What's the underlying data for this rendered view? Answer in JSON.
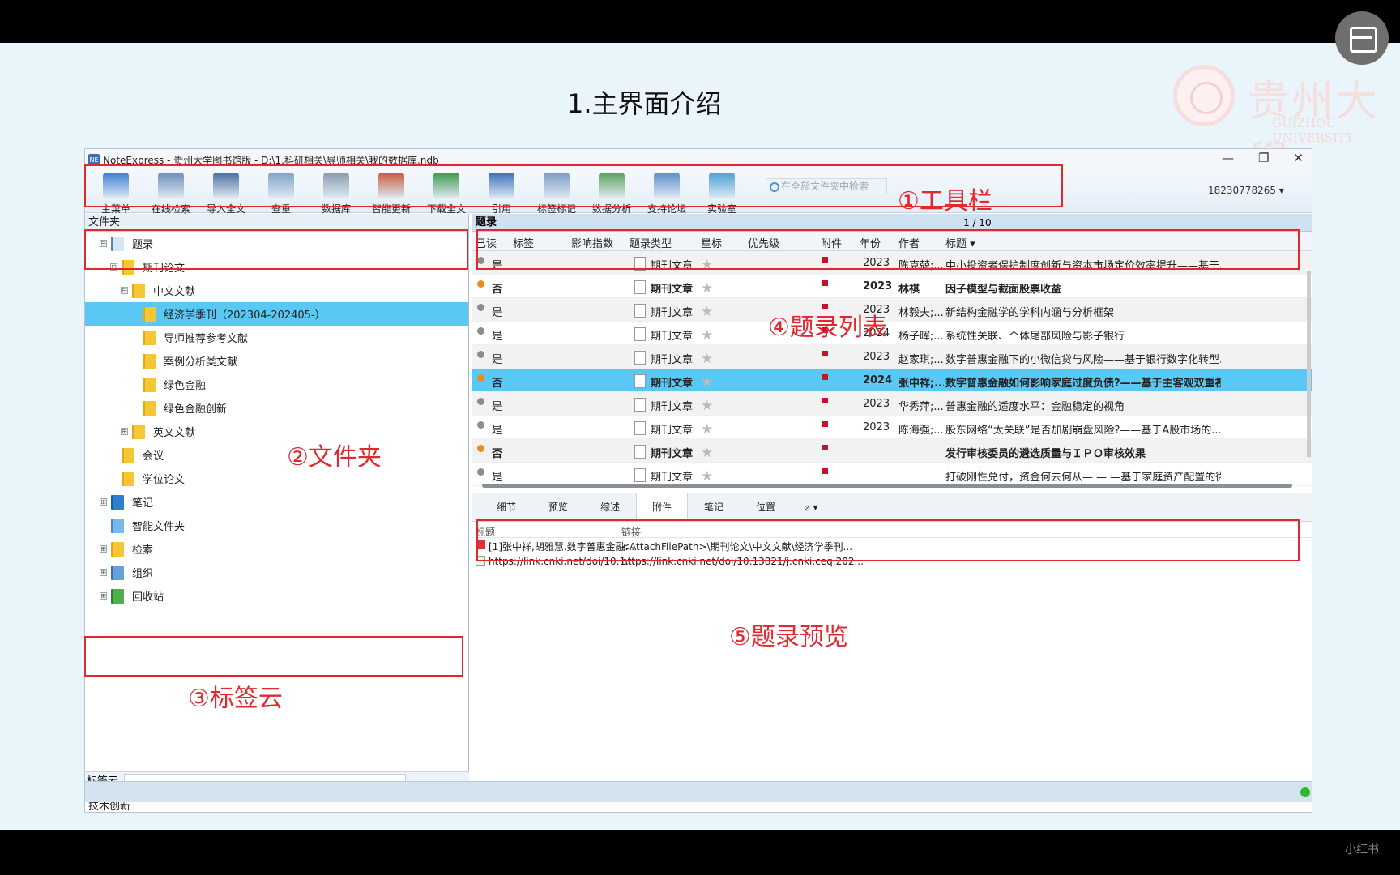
{
  "slide": {
    "title": "1.主界面介绍",
    "logo_text": "贵州大學",
    "logo_sub": "GUIZHOU UNIVERSITY"
  },
  "window": {
    "title": "NoteExpress - 贵州大学图书馆版 - D:\\1.科研相关\\导师相关\\我的数据库.ndb",
    "controls": [
      "—",
      "❐",
      "✕"
    ]
  },
  "toolbar": {
    "buttons": [
      {
        "label": "主菜单",
        "icon": "main-menu-icon"
      },
      {
        "label": "在线检索",
        "icon": "online-search-icon"
      },
      {
        "label": "导入全文",
        "icon": "import-fulltext-icon"
      },
      {
        "label": "查重",
        "icon": "dedup-icon"
      },
      {
        "label": "数据库",
        "icon": "database-icon"
      },
      {
        "label": "智能更新",
        "icon": "smart-update-icon"
      },
      {
        "label": "下载全文",
        "icon": "download-fulltext-icon"
      },
      {
        "label": "引用",
        "icon": "cite-icon"
      },
      {
        "label": "标签标记",
        "icon": "tag-icon"
      },
      {
        "label": "数据分析",
        "icon": "chart-icon"
      },
      {
        "label": "支持论坛",
        "icon": "forum-icon"
      },
      {
        "label": "实验室",
        "icon": "flask-icon"
      }
    ],
    "search_placeholder": "在全部文件夹中检索",
    "user": "18230778265 ▾"
  },
  "annotations": {
    "toolbar": "①工具栏",
    "folders": "②文件夹",
    "tag_cloud": "③标签云",
    "record_list": "④题录列表",
    "record_preview": "⑤题录预览"
  },
  "folders": {
    "header": "文件夹",
    "items": [
      {
        "label": "题录",
        "level": 0,
        "expander": "⊟",
        "type": "list"
      },
      {
        "label": "期刊论文",
        "level": 1,
        "expander": "⊟",
        "type": "folder"
      },
      {
        "label": "中文文献",
        "level": 2,
        "expander": "⊟",
        "type": "folder"
      },
      {
        "label": "经济学季刊（202304-202405-）",
        "level": 3,
        "expander": "",
        "type": "folder",
        "selected": true
      },
      {
        "label": "导师推荐参考文献",
        "level": 3,
        "expander": "",
        "type": "folder"
      },
      {
        "label": "案例分析类文献",
        "level": 3,
        "expander": "",
        "type": "folder"
      },
      {
        "label": "绿色金融",
        "level": 3,
        "expander": "",
        "type": "folder"
      },
      {
        "label": "绿色金融创新",
        "level": 3,
        "expander": "",
        "type": "folder"
      },
      {
        "label": "英文文献",
        "level": 2,
        "expander": "⊞",
        "type": "folder"
      },
      {
        "label": "会议",
        "level": 1,
        "expander": "",
        "type": "folder"
      },
      {
        "label": "学位论文",
        "level": 1,
        "expander": "",
        "type": "folder"
      },
      {
        "label": "笔记",
        "level": 0,
        "expander": "⊞",
        "type": "note"
      },
      {
        "label": "智能文件夹",
        "level": 0,
        "expander": "",
        "type": "smart"
      },
      {
        "label": "检索",
        "level": 0,
        "expander": "⊞",
        "type": "folder"
      },
      {
        "label": "组织",
        "level": 0,
        "expander": "⊞",
        "type": "org"
      },
      {
        "label": "回收站",
        "level": 0,
        "expander": "⊞",
        "type": "trash"
      }
    ]
  },
  "tag_cloud": {
    "header": "标签云",
    "tags": "技术创新"
  },
  "records": {
    "header": "题录",
    "page": "1 / 10",
    "columns": [
      "已读",
      "标签",
      "影响指数",
      "题录类型",
      "星标",
      "优先级",
      "附件",
      "年份",
      "作者",
      "标题 ▾"
    ],
    "rows": [
      {
        "read": "是",
        "type": "期刊文章",
        "year": "2023",
        "author": "陈克兢;...",
        "title": "中小投资者保护制度创新与资本市场定价效率提升——基于...",
        "unread": false
      },
      {
        "read": "否",
        "type": "期刊文章",
        "year": "2023",
        "author": "林祺",
        "title": "因子模型与截面股票收益",
        "unread": true
      },
      {
        "read": "是",
        "type": "期刊文章",
        "year": "2023",
        "author": "林毅夫;...",
        "title": "新结构金融学的学科内涵与分析框架",
        "unread": false
      },
      {
        "read": "是",
        "type": "期刊文章",
        "year": "2024",
        "author": "杨子晖;...",
        "title": "系统性关联、个体尾部风险与影子银行",
        "unread": false
      },
      {
        "read": "是",
        "type": "期刊文章",
        "year": "2023",
        "author": "赵家琪;...",
        "title": "数字普惠金融下的小微信贷与风险——基于银行数字化转型...",
        "unread": false
      },
      {
        "read": "否",
        "type": "期刊文章",
        "year": "2024",
        "author": "张中祥;...",
        "title": "数字普惠金融如何影响家庭过度负债?——基于主客观双重视...",
        "unread": true,
        "selected": true
      },
      {
        "read": "是",
        "type": "期刊文章",
        "year": "2023",
        "author": "华秀萍;...",
        "title": "普惠金融的适度水平：金融稳定的视角",
        "unread": false
      },
      {
        "read": "是",
        "type": "期刊文章",
        "year": "2023",
        "author": "陈海强;...",
        "title": "股东网络“太关联”是否加剧崩盘风险?——基于A股市场的...",
        "unread": false
      },
      {
        "read": "否",
        "type": "期刊文章",
        "year": "",
        "author": "",
        "title": "发行审核委员的遴选质量与ＩＰＯ审核效果",
        "unread": true
      },
      {
        "read": "是",
        "type": "期刊文章",
        "year": "",
        "author": "",
        "title": "打破刚性兑付，资金何去何从— — —基于家庭资产配置的微...",
        "unread": false
      }
    ]
  },
  "preview": {
    "tabs": [
      "细节",
      "预览",
      "综述",
      "附件",
      "笔记",
      "位置"
    ],
    "active_tab": "附件",
    "attach_icon": "paperclip-icon",
    "columns": [
      "标题",
      "链接"
    ],
    "attachments": [
      {
        "title": "[1]张中祥,胡雅慧.数字普惠金融...",
        "link": "<AttachFilePath>\\期刊论文\\中文文献\\经济学季刊...",
        "kind": "pdf"
      },
      {
        "title": "https://link.cnki.net/doi/10.1...",
        "link": "https://link.cnki.net/doi/10.13821/j.cnki.ceq.202...",
        "kind": "url"
      }
    ]
  },
  "watermark": "小红书"
}
